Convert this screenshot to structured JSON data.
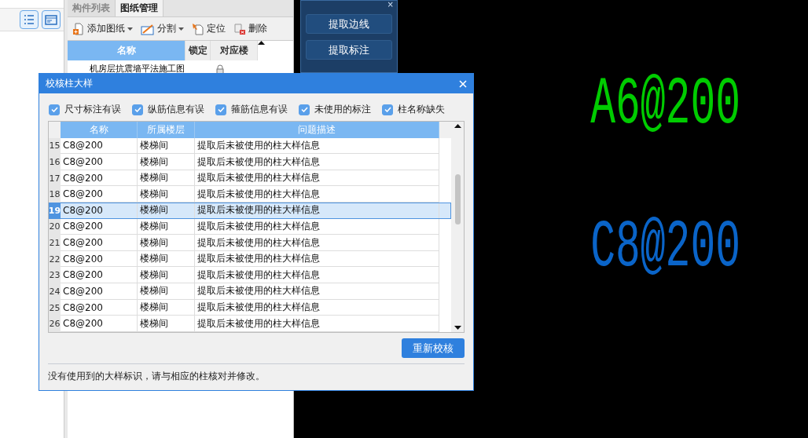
{
  "side_panel": {
    "tabs": [
      {
        "label": "构件列表",
        "selected": false
      },
      {
        "label": "图纸管理",
        "selected": true
      }
    ],
    "toolbar": [
      {
        "label": "添加图纸",
        "dropdown": true
      },
      {
        "label": "分割",
        "dropdown": true
      },
      {
        "label": "定位",
        "dropdown": false
      },
      {
        "label": "删除",
        "dropdown": false
      }
    ],
    "table": {
      "columns": [
        "名称",
        "锁定",
        "对应楼"
      ],
      "rows": [
        {
          "name": "机房层抗震墙平法施工图",
          "locked": true
        }
      ]
    }
  },
  "tool_palette": {
    "close": "×",
    "buttons": [
      "提取边线",
      "提取标注"
    ]
  },
  "canvas": {
    "labels": [
      {
        "text": "A6@200",
        "color": "#00cc00"
      },
      {
        "text": "C8@200",
        "color": "#0a64c8"
      }
    ]
  },
  "dialog": {
    "title": "校核柱大样",
    "filters": [
      {
        "label": "尺寸标注有误",
        "checked": true
      },
      {
        "label": "纵筋信息有误",
        "checked": true
      },
      {
        "label": "箍筋信息有误",
        "checked": true
      },
      {
        "label": "未使用的标注",
        "checked": true
      },
      {
        "label": "柱名称缺失",
        "checked": true
      }
    ],
    "columns": [
      "名称",
      "所属楼层",
      "问题描述"
    ],
    "rows": [
      {
        "index": "15",
        "name": "C8@200",
        "floor": "楼梯间",
        "issue": "提取后未被使用的柱大样信息",
        "selected": false
      },
      {
        "index": "16",
        "name": "C8@200",
        "floor": "楼梯间",
        "issue": "提取后未被使用的柱大样信息",
        "selected": false
      },
      {
        "index": "17",
        "name": "C8@200",
        "floor": "楼梯间",
        "issue": "提取后未被使用的柱大样信息",
        "selected": false
      },
      {
        "index": "18",
        "name": "C8@200",
        "floor": "楼梯间",
        "issue": "提取后未被使用的柱大样信息",
        "selected": false
      },
      {
        "index": "19",
        "name": "C8@200",
        "floor": "楼梯间",
        "issue": "提取后未被使用的柱大样信息",
        "selected": true
      },
      {
        "index": "20",
        "name": "C8@200",
        "floor": "楼梯间",
        "issue": "提取后未被使用的柱大样信息",
        "selected": false
      },
      {
        "index": "21",
        "name": "C8@200",
        "floor": "楼梯间",
        "issue": "提取后未被使用的柱大样信息",
        "selected": false
      },
      {
        "index": "22",
        "name": "C8@200",
        "floor": "楼梯间",
        "issue": "提取后未被使用的柱大样信息",
        "selected": false
      },
      {
        "index": "23",
        "name": "C8@200",
        "floor": "楼梯间",
        "issue": "提取后未被使用的柱大样信息",
        "selected": false
      },
      {
        "index": "24",
        "name": "C8@200",
        "floor": "楼梯间",
        "issue": "提取后未被使用的柱大样信息",
        "selected": false
      },
      {
        "index": "25",
        "name": "C8@200",
        "floor": "楼梯间",
        "issue": "提取后未被使用的柱大样信息",
        "selected": false
      },
      {
        "index": "26",
        "name": "C8@200",
        "floor": "楼梯间",
        "issue": "提取后未被使用的柱大样信息",
        "selected": false
      }
    ],
    "button": "重新校核",
    "status": "没有使用到的大样标识，请与相应的柱核对并修改。"
  }
}
